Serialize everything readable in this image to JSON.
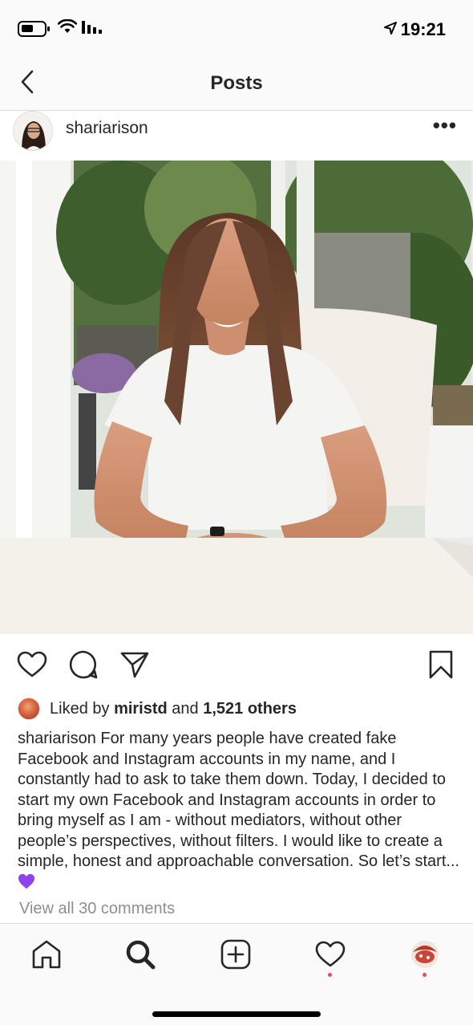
{
  "status_bar": {
    "time": "19:21"
  },
  "nav": {
    "title": "Posts"
  },
  "post": {
    "username": "shariarison",
    "more_label": "•••",
    "likes": {
      "prefix": "Liked by ",
      "user": "miristd",
      "middle": " and ",
      "count": "1,521 others"
    },
    "caption": {
      "username": "shariarison",
      "text": "For many years people have created fake Facebook and Instagram accounts in my name, and I constantly had to ask to take them down. Today, I decided to start my own Facebook and Instagram accounts in order to bring myself as I am - without mediators, without other people’s perspectives, without filters. I would like to create a simple, honest and approachable conversation. So let’s start..."
    },
    "view_comments": "View all 30 comments"
  },
  "icons": {
    "status": [
      "battery-icon",
      "wifi-icon",
      "signal-icon",
      "location-arrow-icon"
    ],
    "actions": [
      "heart-icon",
      "comment-icon",
      "share-icon",
      "bookmark-icon"
    ],
    "tabs": [
      "home-icon",
      "search-icon",
      "add-post-icon",
      "activity-heart-icon",
      "profile-avatar"
    ]
  },
  "colors": {
    "accent_red": "#ed4956",
    "purple_heart": "#8e44ec",
    "muted_text": "#8e8e8e",
    "text": "#262626"
  }
}
